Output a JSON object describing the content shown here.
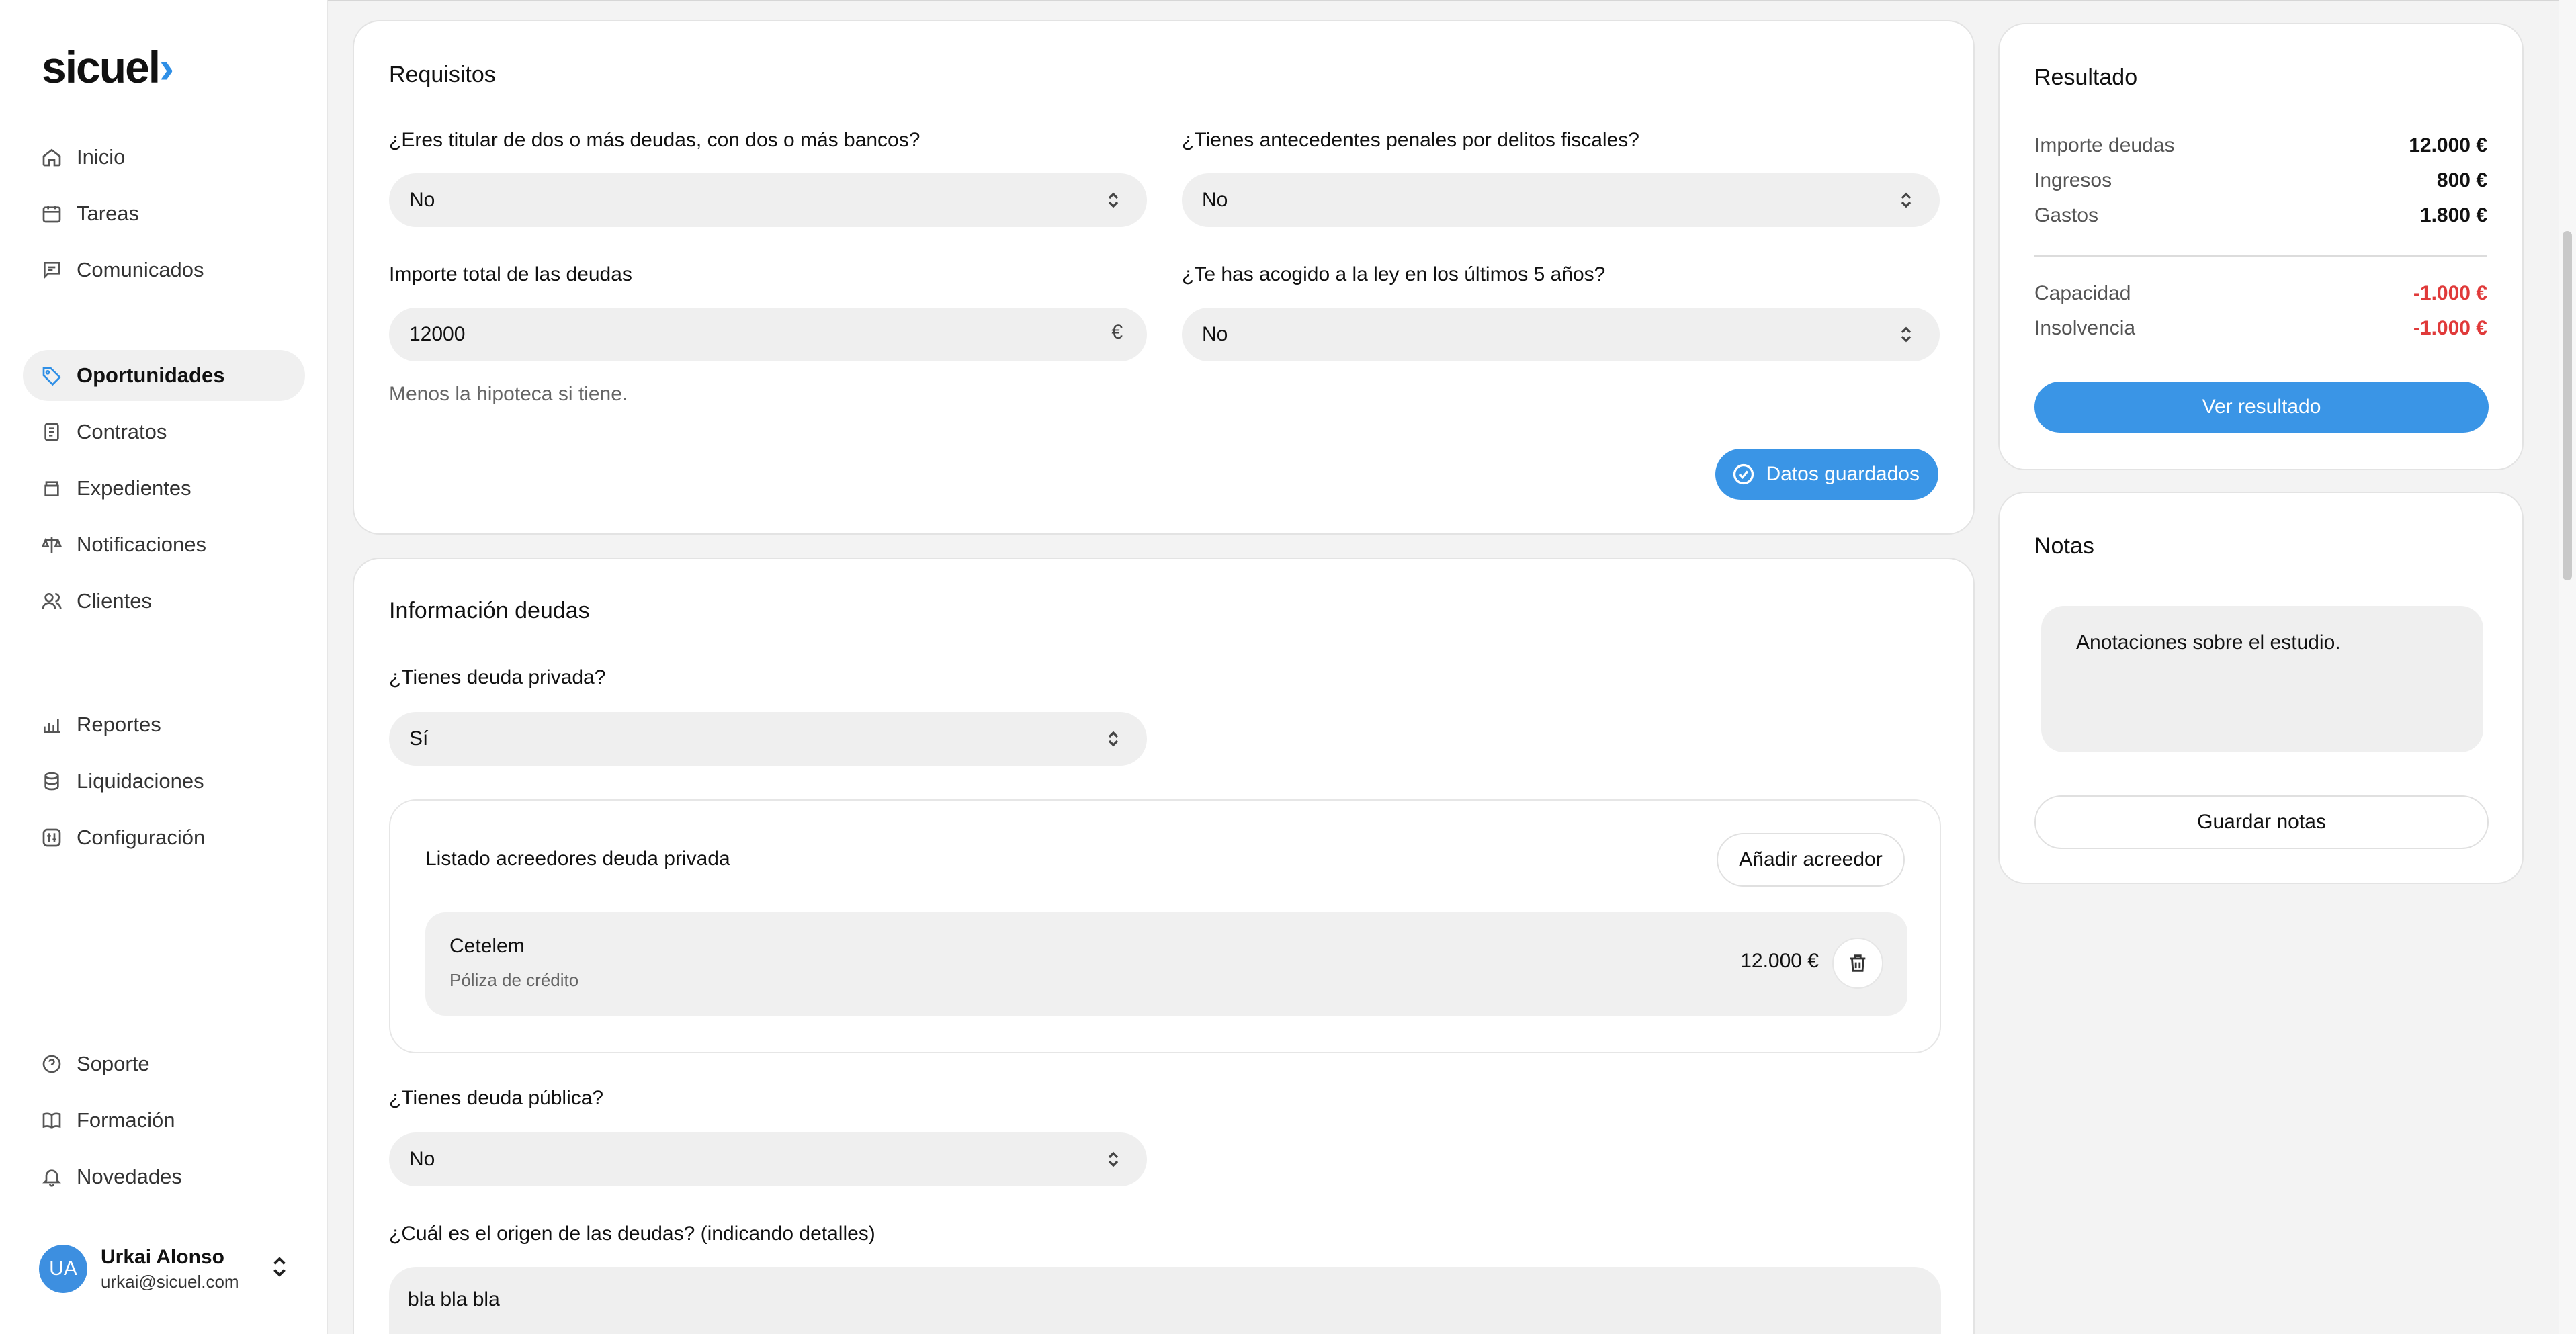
{
  "brand": {
    "name": "sicuel",
    "mark": "›",
    "accent": "#2f8fe6"
  },
  "nav": {
    "primary": [
      {
        "label": "Inicio",
        "icon": "home-icon"
      },
      {
        "label": "Tareas",
        "icon": "calendar-icon"
      },
      {
        "label": "Comunicados",
        "icon": "message-icon"
      }
    ],
    "work": [
      {
        "label": "Oportunidades",
        "icon": "tag-icon",
        "active": true
      },
      {
        "label": "Contratos",
        "icon": "document-icon"
      },
      {
        "label": "Expedientes",
        "icon": "folder-icon"
      },
      {
        "label": "Notificaciones",
        "icon": "scale-icon"
      },
      {
        "label": "Clientes",
        "icon": "users-icon"
      }
    ],
    "reports": [
      {
        "label": "Reportes",
        "icon": "chart-icon"
      },
      {
        "label": "Liquidaciones",
        "icon": "coins-icon"
      },
      {
        "label": "Configuración",
        "icon": "settings-icon"
      }
    ],
    "bottom": [
      {
        "label": "Soporte",
        "icon": "help-icon"
      },
      {
        "label": "Formación",
        "icon": "book-icon"
      },
      {
        "label": "Novedades",
        "icon": "bell-icon"
      }
    ]
  },
  "user": {
    "initials": "UA",
    "name": "Urkai Alonso",
    "email": "urkai@sicuel.com"
  },
  "requisitos": {
    "title": "Requisitos",
    "q1": {
      "label": "¿Eres titular de dos o más deudas, con dos o más bancos?",
      "value": "No"
    },
    "q2": {
      "label": "¿Tienes antecedentes penales por delitos fiscales?",
      "value": "No"
    },
    "q3": {
      "label": "Importe total de las deudas",
      "value": "12000",
      "unit": "€",
      "hint": "Menos la hipoteca si tiene."
    },
    "q4": {
      "label": "¿Te has acogido a la ley en los últimos 5 años?",
      "value": "No"
    },
    "saved_label": "Datos guardados"
  },
  "deudas": {
    "title": "Información deudas",
    "privada": {
      "label": "¿Tienes deuda privada?",
      "value": "Sí"
    },
    "acreedores": {
      "title": "Listado acreedores deuda privada",
      "add_label": "Añadir acreedor",
      "items": [
        {
          "name": "Cetelem",
          "type": "Póliza de crédito",
          "amount": "12.000 €"
        }
      ]
    },
    "publica": {
      "label": "¿Tienes deuda pública?",
      "value": "No"
    },
    "origen": {
      "label": "¿Cuál es el origen de las deudas? (indicando detalles)",
      "value": "bla bla bla"
    }
  },
  "resultado": {
    "title": "Resultado",
    "rows": [
      {
        "label": "Importe deudas",
        "value": "12.000 €"
      },
      {
        "label": "Ingresos",
        "value": "800 €"
      },
      {
        "label": "Gastos",
        "value": "1.800 €"
      }
    ],
    "rows2": [
      {
        "label": "Capacidad",
        "value": "-1.000 €"
      },
      {
        "label": "Insolvencia",
        "value": "-1.000 €"
      }
    ],
    "button": "Ver resultado",
    "negative_color": "#e03a3a"
  },
  "notas": {
    "title": "Notas",
    "text": "Anotaciones sobre el estudio.",
    "button": "Guardar notas"
  }
}
